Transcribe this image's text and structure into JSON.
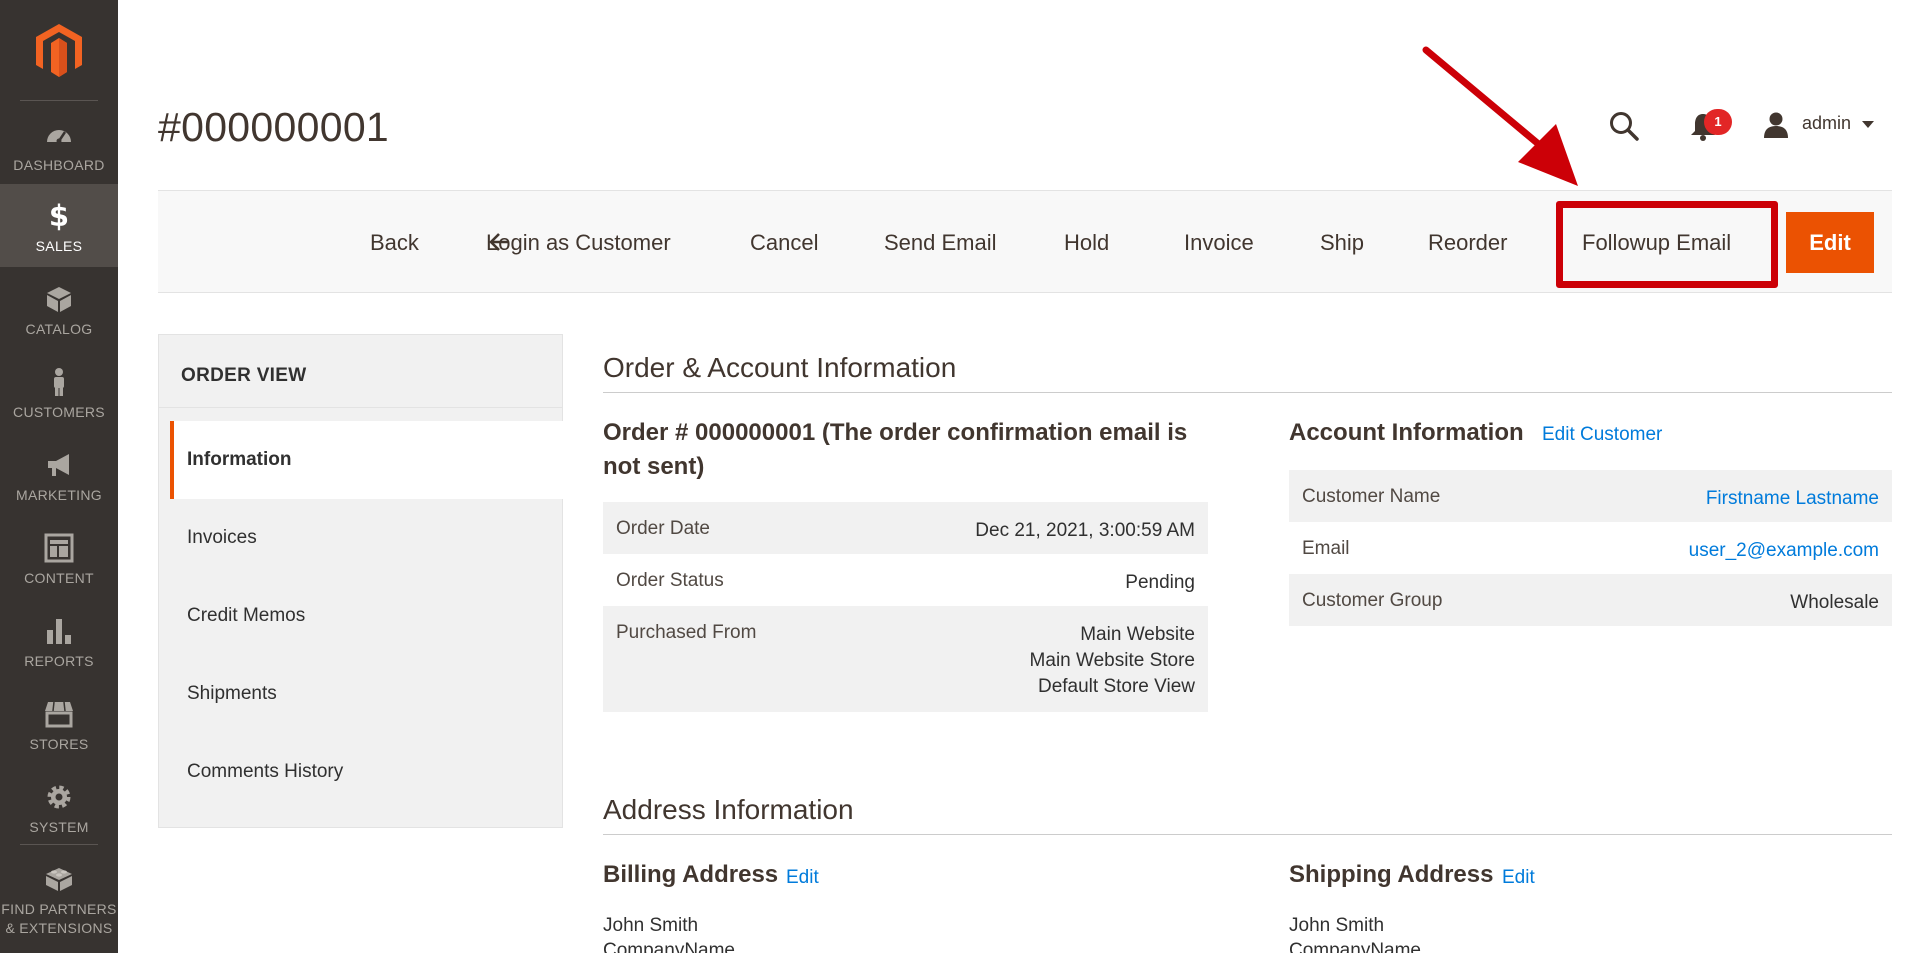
{
  "menu": {
    "items": [
      {
        "key": "dashboard",
        "label": "DASHBOARD",
        "icon": "dashboard-gauge-icon"
      },
      {
        "key": "sales",
        "label": "SALES",
        "icon": "dollar-icon",
        "glyph": "$",
        "active": true
      },
      {
        "key": "catalog",
        "label": "CATALOG",
        "icon": "cube-icon"
      },
      {
        "key": "customers",
        "label": "CUSTOMERS",
        "icon": "person-icon"
      },
      {
        "key": "marketing",
        "label": "MARKETING",
        "icon": "megaphone-icon"
      },
      {
        "key": "content",
        "label": "CONTENT",
        "icon": "layout-icon"
      },
      {
        "key": "reports",
        "label": "REPORTS",
        "icon": "bar-chart-icon"
      },
      {
        "key": "stores",
        "label": "STORES",
        "icon": "storefront-icon"
      },
      {
        "key": "system",
        "label": "SYSTEM",
        "icon": "gear-icon"
      }
    ],
    "partners": {
      "label_line1": "FIND PARTNERS",
      "label_line2": "& EXTENSIONS",
      "icon": "lego-block-icon"
    }
  },
  "header": {
    "title": "#000000001",
    "notifications_count": "1",
    "user_name": "admin"
  },
  "toolbar": {
    "back": "Back",
    "login_as_customer": "Login as Customer",
    "cancel": "Cancel",
    "send_email": "Send Email",
    "hold": "Hold",
    "invoice": "Invoice",
    "ship": "Ship",
    "reorder": "Reorder",
    "followup_email": "Followup Email",
    "edit": "Edit"
  },
  "colors": {
    "accent": "#eb5202",
    "highlight_red": "#cc0007",
    "link": "#007bdb",
    "menu_bg": "#373330"
  },
  "side_panel": {
    "title": "ORDER VIEW",
    "tabs": [
      "Information",
      "Invoices",
      "Credit Memos",
      "Shipments",
      "Comments History"
    ],
    "active_tab": "Information"
  },
  "order_account": {
    "section_title": "Order & Account Information",
    "order_heading": "Order # 000000001 (The order confirmation email is not sent)",
    "order_rows": [
      {
        "label": "Order Date",
        "value": "Dec 21, 2021, 3:00:59 AM"
      },
      {
        "label": "Order Status",
        "value": "Pending"
      },
      {
        "label": "Purchased From",
        "value_lines": [
          "Main Website",
          "Main Website Store",
          "Default Store View"
        ]
      }
    ],
    "account_heading": "Account Information",
    "account_edit": "Edit Customer",
    "account_rows": [
      {
        "label": "Customer Name",
        "value": "Firstname Lastname",
        "link": true
      },
      {
        "label": "Email",
        "value": "user_2@example.com",
        "link": true
      },
      {
        "label": "Customer Group",
        "value": "Wholesale",
        "link": false
      }
    ]
  },
  "address": {
    "section_title": "Address Information",
    "billing_heading": "Billing Address",
    "billing_edit": "Edit",
    "billing_lines": [
      "John Smith",
      "CompanyName"
    ],
    "shipping_heading": "Shipping Address",
    "shipping_edit": "Edit",
    "shipping_lines": [
      "John Smith",
      "CompanyName"
    ]
  }
}
